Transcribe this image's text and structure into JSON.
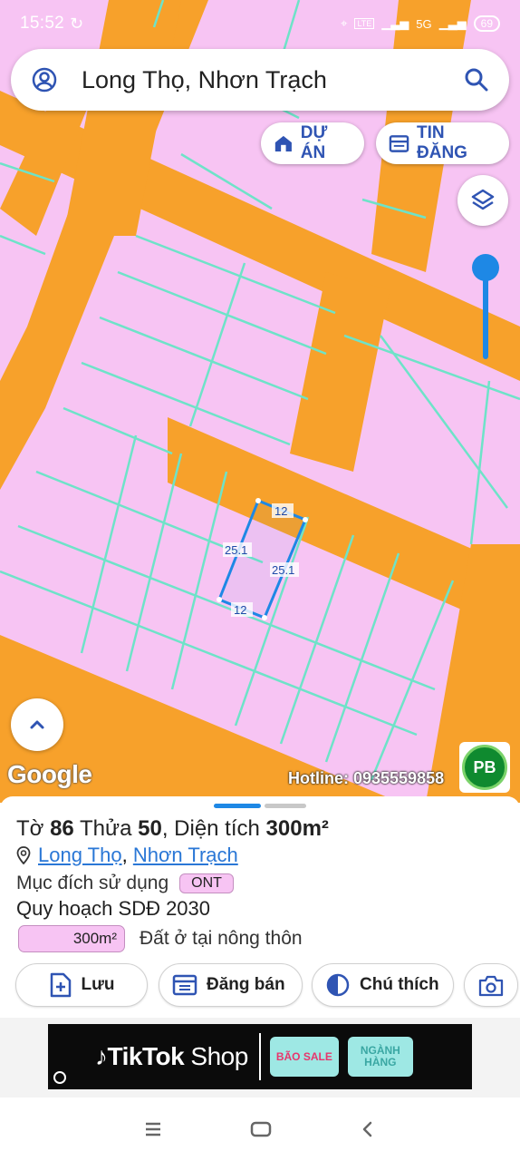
{
  "status_bar": {
    "time": "15:52",
    "network": "5G",
    "battery": "69"
  },
  "search": {
    "title": "Long Thọ, Nhơn Trạch"
  },
  "top_buttons": {
    "du_an": "DỰ ÁN",
    "tin_dang": "TIN ĐĂNG"
  },
  "map": {
    "plot_labels": {
      "top": "12",
      "left": "25.1",
      "right": "25.1",
      "bottom": "12"
    },
    "google_label": "Google",
    "hotline": "Hotline: 0935559858",
    "partner_logo_text": "PB",
    "colors": {
      "residential": "#f7c4f3",
      "road": "#f7a12b",
      "parcel_line": "#6ee3c8",
      "selection": "#1e88e5"
    }
  },
  "sheet": {
    "title_prefix": "Tờ",
    "sheet_no": "86",
    "plot_prefix": "Thửa",
    "plot_no": "50",
    "area_prefix": ", Diện tích",
    "area": "300m²",
    "location_1": "Long Thọ",
    "location_sep": ",",
    "location_2": "Nhơn Trạch",
    "purpose_label": "Mục đích sử dụng",
    "purpose_code": "ONT",
    "plan_label": "Quy hoạch SDĐ 2030",
    "plan_area": "300m²",
    "plan_desc": "Đất ở tại nông thôn"
  },
  "actions": {
    "save": "Lưu",
    "post": "Đăng bán",
    "legend": "Chú thích"
  },
  "ad": {
    "brand": "TikTok",
    "brand_suffix": " Shop",
    "promo_1": "BÃO SALE",
    "promo_2": "NGÀNH HÀNG"
  }
}
